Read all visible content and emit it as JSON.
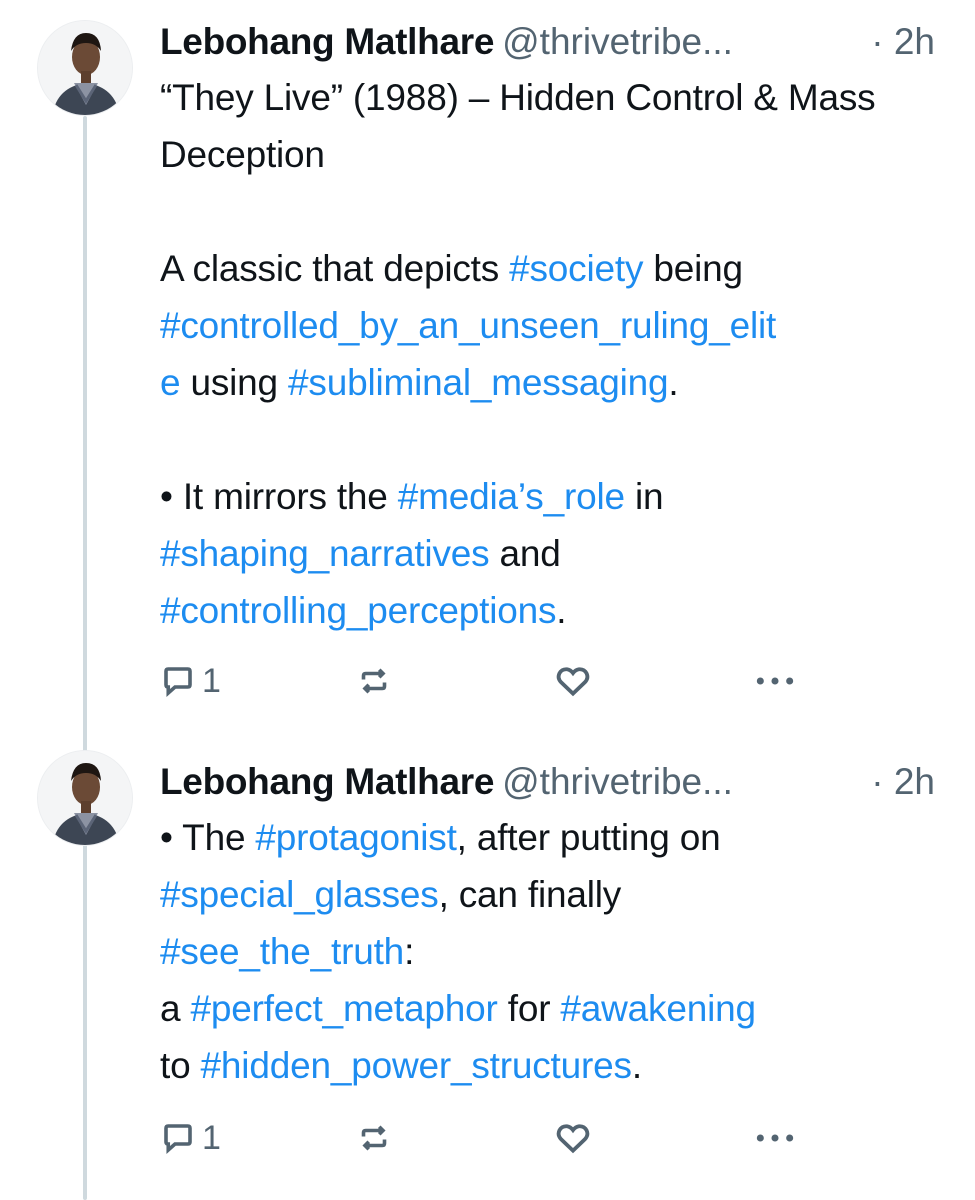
{
  "posts": [
    {
      "author": {
        "name": "Lebohang Matlhare",
        "handle": "@thrivetribe...",
        "separator": "·",
        "time": "2h"
      },
      "paragraphs": [
        [
          {
            "t": "“They Live” (1988) – Hidden Control & Mass Deception"
          }
        ],
        [
          {
            "t": "A classic that depicts "
          },
          {
            "t": "#society",
            "tag": true
          },
          {
            "t": " being "
          },
          {
            "t": "#controlled_by_an_unseen_ruling_elit",
            "tag": true
          },
          {
            "br": true
          },
          {
            "t": "e",
            "tag": true
          },
          {
            "t": " using "
          },
          {
            "t": "#subliminal_messaging",
            "tag": true
          },
          {
            "t": "."
          }
        ],
        [
          {
            "t": "• It mirrors the "
          },
          {
            "t": "#media’s_role",
            "tag": true
          },
          {
            "t": " in "
          },
          {
            "br": true
          },
          {
            "t": "#shaping_narratives",
            "tag": true
          },
          {
            "t": " and "
          },
          {
            "br": true
          },
          {
            "t": "#controlling_perceptions",
            "tag": true
          },
          {
            "t": "."
          }
        ]
      ],
      "actions": {
        "reply_icon": "reply-icon",
        "reply_count": "1",
        "repost_icon": "repost-icon",
        "like_icon": "heart-icon",
        "more_icon": "more-icon"
      }
    },
    {
      "author": {
        "name": "Lebohang Matlhare",
        "handle": "@thrivetribe...",
        "separator": "·",
        "time": "2h"
      },
      "paragraphs": [
        [
          {
            "t": "• The "
          },
          {
            "t": "#protagonist",
            "tag": true
          },
          {
            "t": ", after putting on "
          },
          {
            "br": true
          },
          {
            "t": "#special_glasses",
            "tag": true
          },
          {
            "t": ", can finally "
          },
          {
            "br": true
          },
          {
            "t": "#see_the_truth",
            "tag": true
          },
          {
            "t": ":"
          },
          {
            "br": true
          },
          {
            "t": "a "
          },
          {
            "t": "#perfect_metaphor",
            "tag": true
          },
          {
            "t": " for "
          },
          {
            "t": "#awakening",
            "tag": true
          },
          {
            "br": true
          },
          {
            "t": "to "
          },
          {
            "t": "#hidden_power_structures",
            "tag": true
          },
          {
            "t": "."
          }
        ]
      ],
      "actions": {
        "reply_icon": "reply-icon",
        "reply_count": "1",
        "repost_icon": "repost-icon",
        "like_icon": "heart-icon",
        "more_icon": "more-icon"
      }
    }
  ],
  "colors": {
    "hashtag": "#1d8cf0",
    "text": "#0f1419",
    "muted": "#536471",
    "thread_line": "#cfd9de"
  }
}
